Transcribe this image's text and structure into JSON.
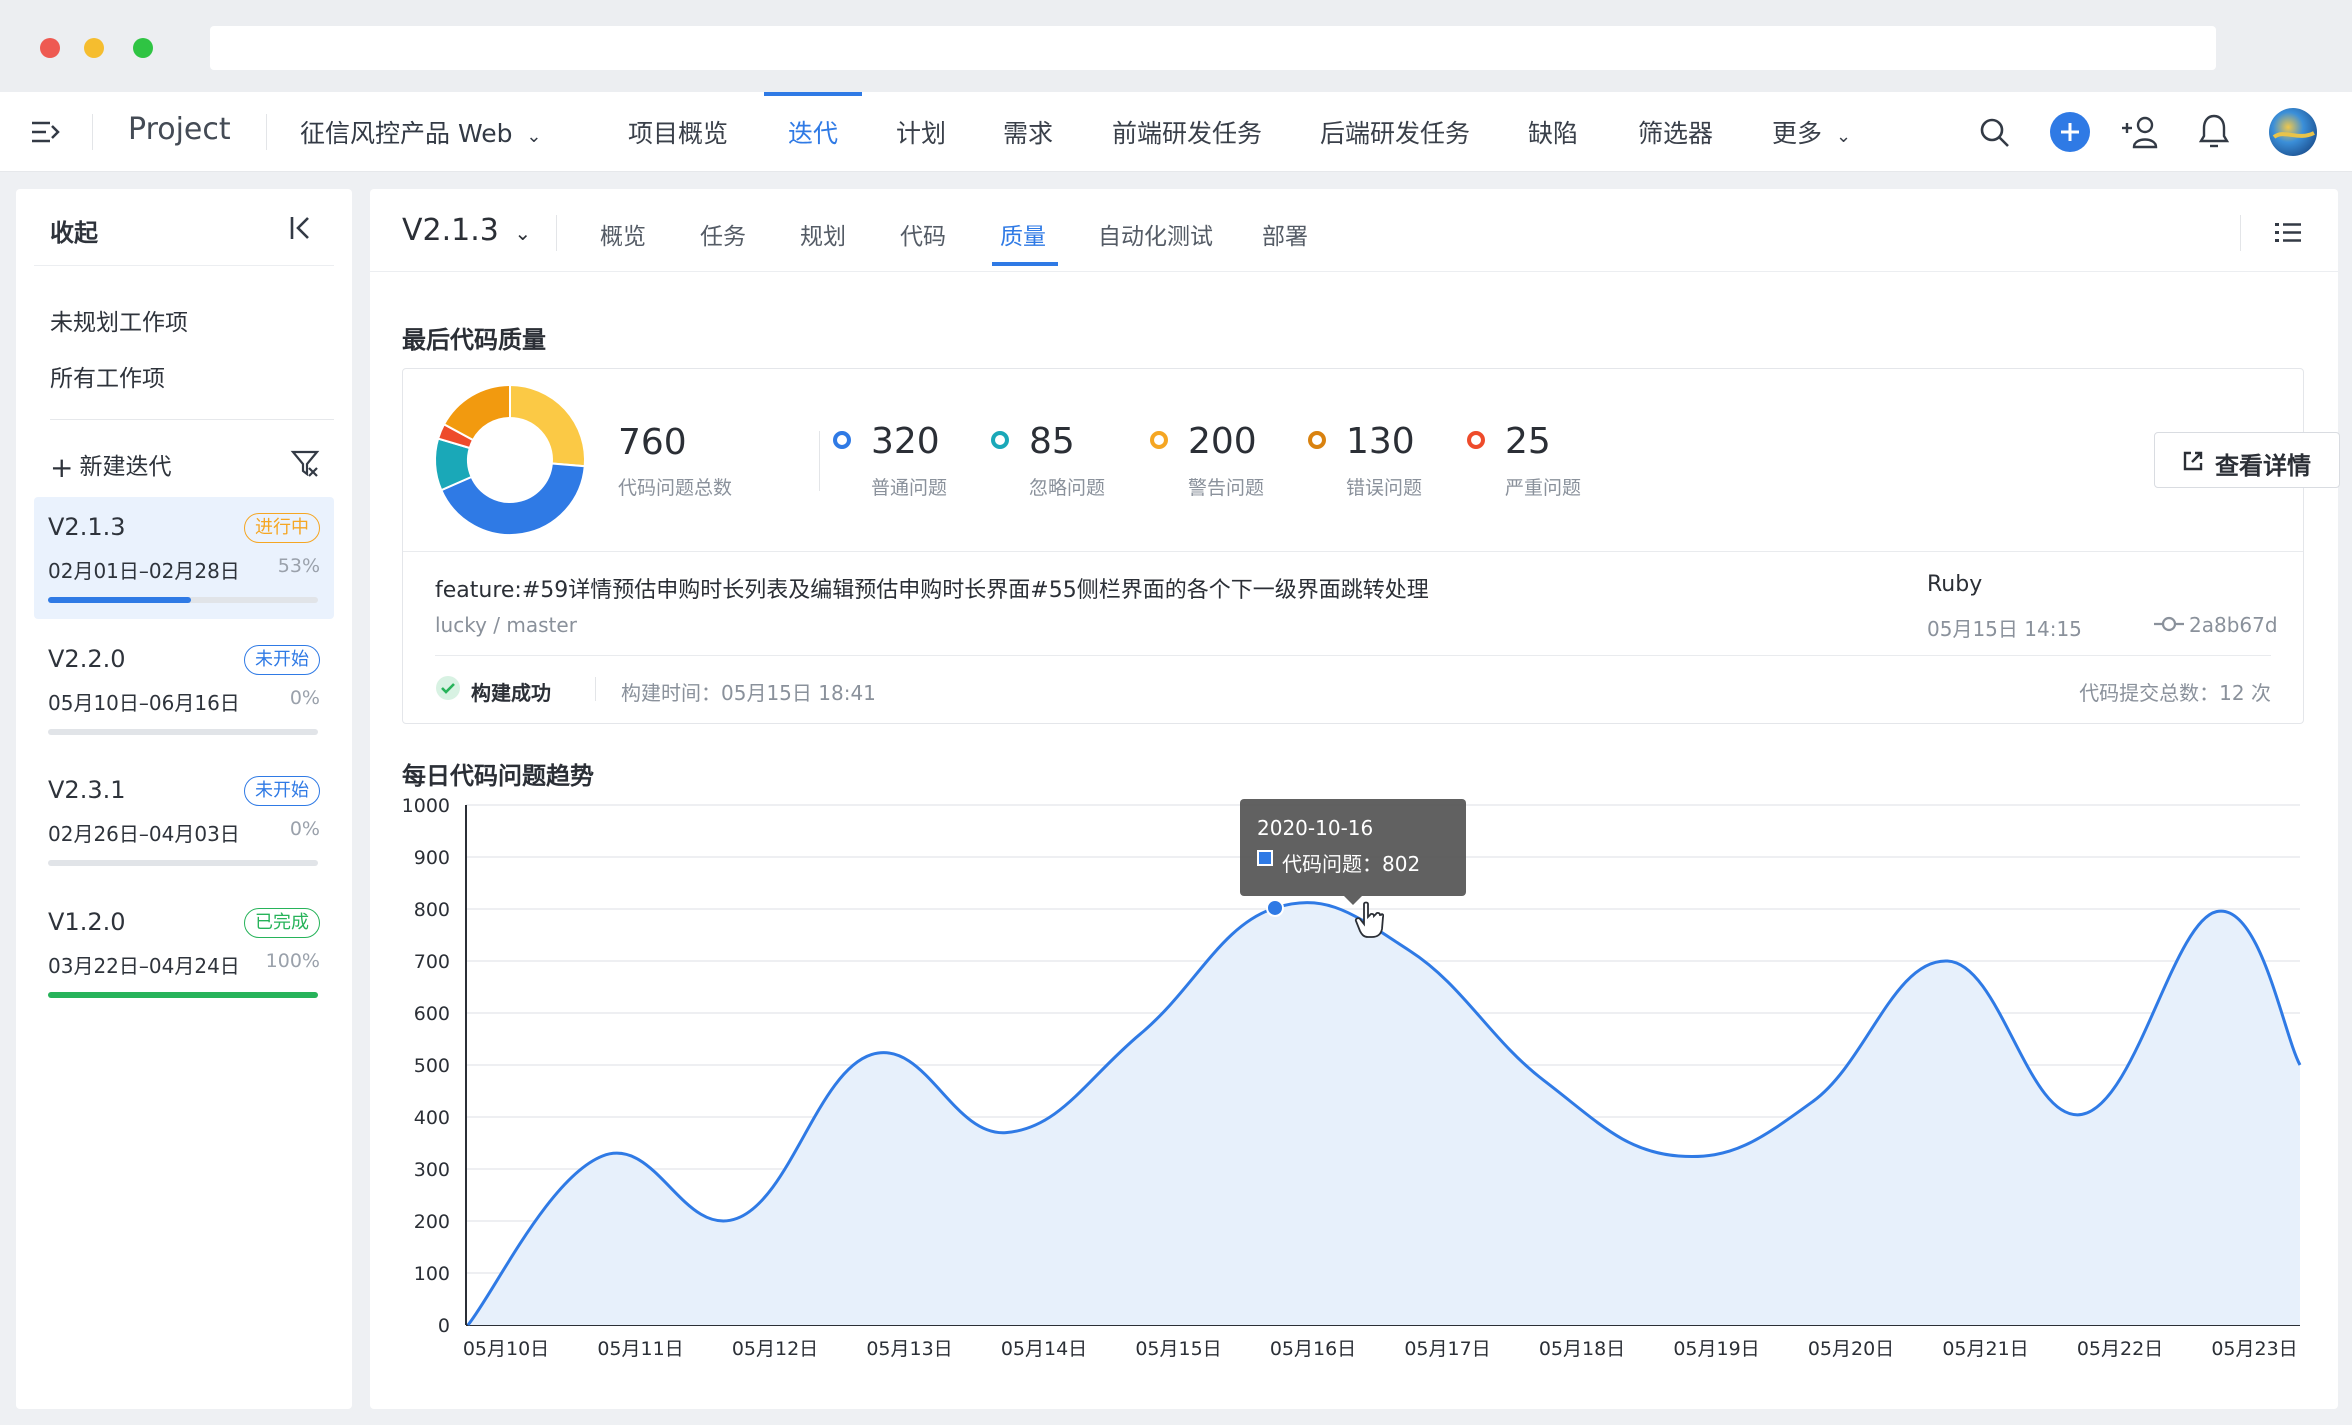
{
  "header": {
    "project_label": "Project",
    "product_name": "征信风控产品 Web",
    "nav": [
      "项目概览",
      "迭代",
      "计划",
      "需求",
      "前端研发任务",
      "后端研发任务",
      "缺陷",
      "筛选器",
      "更多"
    ],
    "active_nav": "迭代"
  },
  "sidebar": {
    "collapse_label": "收起",
    "links": [
      "未规划工作项",
      "所有工作项"
    ],
    "new_iteration_label": "新建迭代",
    "iterations": [
      {
        "name": "V2.1.3",
        "status": "进行中",
        "dates": "02月01日–02月28日",
        "percent": "53%",
        "progress": 0.53,
        "status_color": "#f5a623",
        "bar_color": "#2f7ae5"
      },
      {
        "name": "V2.2.0",
        "status": "未开始",
        "dates": "05月10日–06月16日",
        "percent": "0%",
        "progress": 0.0,
        "status_color": "#2f7ae5",
        "bar_color": "#2f7ae5"
      },
      {
        "name": "V2.3.1",
        "status": "未开始",
        "dates": "02月26日–04月03日",
        "percent": "0%",
        "progress": 0.0,
        "status_color": "#2f7ae5",
        "bar_color": "#2f7ae5"
      },
      {
        "name": "V1.2.0",
        "status": "已完成",
        "dates": "03月22日–04月24日",
        "percent": "100%",
        "progress": 1.0,
        "status_color": "#27b35a",
        "bar_color": "#27b35a"
      }
    ]
  },
  "main": {
    "version": "V2.1.3",
    "tabs": [
      "概览",
      "任务",
      "规划",
      "代码",
      "质量",
      "自动化测试",
      "部署"
    ],
    "active_tab": "质量",
    "quality_title": "最后代码质量",
    "total_value": "760",
    "total_label": "代码问题总数",
    "stats": [
      {
        "value": "320",
        "label": "普通问题",
        "color": "#2f7ae5"
      },
      {
        "value": "85",
        "label": "忽略问题",
        "color": "#1aa8b8"
      },
      {
        "value": "200",
        "label": "警告问题",
        "color": "#f5a623"
      },
      {
        "value": "130",
        "label": "错误问题",
        "color": "#d9820f"
      },
      {
        "value": "25",
        "label": "严重问题",
        "color": "#ee4b2b"
      }
    ],
    "detail_button": "查看详情",
    "commit_message": "feature:#59详情预估申购时长列表及编辑预估申购时长界面#55侧栏界面的各个下一级界面跳转处理",
    "commit_branch": "lucky / master",
    "commit_author": "Ruby",
    "commit_time": "05月15日 14:15",
    "commit_hash": "2a8b67d",
    "build_status": "构建成功",
    "build_time": "构建时间：05月15日 18:41",
    "commit_count": "代码提交总数：12 次",
    "trend_title": "每日代码问题趋势",
    "tooltip_date": "2020-10-16",
    "tooltip_label": "代码问题：802"
  },
  "colors": {
    "accent": "#2f7ae5",
    "area_fill": "#e7f0fb"
  },
  "chart_data": [
    {
      "type": "pie",
      "categories": [
        "普通问题",
        "忽略问题",
        "警告问题",
        "错误问题",
        "严重问题"
      ],
      "values": [
        320,
        85,
        200,
        130,
        25
      ],
      "colors": [
        "#2f7ae5",
        "#1aa8b8",
        "#fbc945",
        "#f29a0f",
        "#ee4b2b"
      ],
      "title": ""
    },
    {
      "type": "area",
      "title": "每日代码问题趋势",
      "categories": [
        "05月10日",
        "05月11日",
        "05月12日",
        "05月13日",
        "05月14日",
        "05月15日",
        "05月16日",
        "05月17日",
        "05月18日",
        "05月19日",
        "05月20日",
        "05月21日",
        "05月22日",
        "05月23日"
      ],
      "series": [
        {
          "name": "代码问题",
          "values": [
            0,
            325,
            205,
            520,
            370,
            560,
            802,
            720,
            470,
            325,
            430,
            700,
            405,
            795
          ]
        }
      ],
      "end_value": 500,
      "ylim": [
        0,
        1000
      ],
      "yticks": [
        0,
        100,
        200,
        300,
        400,
        500,
        600,
        700,
        800,
        900,
        1000
      ],
      "grid": true,
      "highlight_index": 6
    }
  ]
}
